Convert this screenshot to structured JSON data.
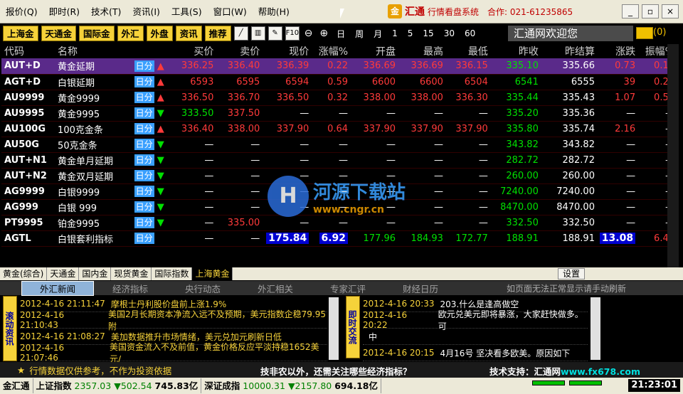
{
  "menu": [
    "报价(Q)",
    "即时(R)",
    "技术(T)",
    "资讯(I)",
    "工具(S)",
    "窗口(W)",
    "帮助(H)"
  ],
  "brand": {
    "logo": "金",
    "name": "汇通",
    "sub": "行情看盘系统",
    "phone": "合作: 021-61235865"
  },
  "window_buttons": [
    "_",
    "▫",
    "×"
  ],
  "toolbar": {
    "markets": [
      "上海金",
      "天通金",
      "国际金",
      "外汇",
      "外盘",
      "资讯",
      "推荐"
    ],
    "f10": "F10",
    "periods": [
      "日",
      "周",
      "月",
      "1",
      "5",
      "15",
      "30",
      "60"
    ],
    "welcome": "汇通网欢迎您",
    "mail_count": "(0)"
  },
  "table": {
    "headers": [
      "代码",
      "名称",
      "",
      "买价",
      "卖价",
      "现价",
      "涨幅%",
      "开盘",
      "最高",
      "最低",
      "昨收",
      "昨结算",
      "涨跌",
      "振幅%"
    ],
    "tag": "日分",
    "rows": [
      {
        "code": "AUT+D",
        "name": "黄金延期",
        "dir": "up",
        "buy": "336.25",
        "sell": "336.40",
        "price": "336.39",
        "pct": "0.22",
        "open": "336.69",
        "high": "336.69",
        "low": "336.15",
        "prev": "335.10",
        "settle": "335.66",
        "chg": "0.73",
        "amp": "0.16",
        "sel": true
      },
      {
        "code": "AGT+D",
        "name": "白银延期",
        "dir": "up",
        "buy": "6593",
        "sell": "6595",
        "price": "6594",
        "pct": "0.59",
        "open": "6600",
        "high": "6600",
        "low": "6504",
        "prev": "6541",
        "settle": "6555",
        "chg": "39",
        "amp": "0.24"
      },
      {
        "code": "AU9999",
        "name": "黄金9999",
        "dir": "up",
        "buy": "336.50",
        "sell": "336.70",
        "price": "336.50",
        "pct": "0.32",
        "open": "338.00",
        "high": "338.00",
        "low": "336.30",
        "prev": "335.44",
        "settle": "335.43",
        "chg": "1.07",
        "amp": "0.51"
      },
      {
        "code": "AU9995",
        "name": "黄金9995",
        "dir": "down",
        "buy": "333.50",
        "sell": "337.50",
        "price": "—",
        "pct": "—",
        "open": "—",
        "high": "—",
        "low": "—",
        "prev": "335.20",
        "settle": "335.36",
        "chg": "—",
        "amp": "—"
      },
      {
        "code": "AU100G",
        "name": "100克金条",
        "dir": "up",
        "buy": "336.40",
        "sell": "338.00",
        "price": "337.90",
        "pct": "0.64",
        "open": "337.90",
        "high": "337.90",
        "low": "337.90",
        "prev": "335.80",
        "settle": "335.74",
        "chg": "2.16",
        "amp": "—"
      },
      {
        "code": "AU50G",
        "name": "50克金条",
        "dir": "down",
        "buy": "—",
        "sell": "—",
        "price": "—",
        "pct": "—",
        "open": "—",
        "high": "—",
        "low": "—",
        "prev": "343.82",
        "settle": "343.82",
        "chg": "—",
        "amp": "—"
      },
      {
        "code": "AUT+N1",
        "name": "黄金单月延期",
        "dir": "down",
        "buy": "—",
        "sell": "—",
        "price": "—",
        "pct": "—",
        "open": "—",
        "high": "—",
        "low": "—",
        "prev": "282.72",
        "settle": "282.72",
        "chg": "—",
        "amp": "—"
      },
      {
        "code": "AUT+N2",
        "name": "黄金双月延期",
        "dir": "down",
        "buy": "—",
        "sell": "—",
        "price": "—",
        "pct": "—",
        "open": "—",
        "high": "—",
        "low": "—",
        "prev": "260.00",
        "settle": "260.00",
        "chg": "—",
        "amp": "—"
      },
      {
        "code": "AG9999",
        "name": "白银9999",
        "dir": "down",
        "buy": "—",
        "sell": "—",
        "price": "—",
        "pct": "—",
        "open": "—",
        "high": "—",
        "low": "—",
        "prev": "7240.00",
        "settle": "7240.00",
        "chg": "—",
        "amp": "—"
      },
      {
        "code": "AG999",
        "name": "白银 999",
        "dir": "down",
        "buy": "—",
        "sell": "—",
        "price": "—",
        "pct": "—",
        "open": "—",
        "high": "—",
        "low": "—",
        "prev": "8470.00",
        "settle": "8470.00",
        "chg": "—",
        "amp": "—"
      },
      {
        "code": "PT9995",
        "name": "铂金9995",
        "dir": "down",
        "buy": "—",
        "sell": "335.00",
        "price": "—",
        "pct": "—",
        "open": "—",
        "high": "—",
        "low": "—",
        "prev": "332.50",
        "settle": "332.50",
        "chg": "—",
        "amp": "—"
      },
      {
        "code": "AGTL",
        "name": "白银套利指标",
        "dir": "none",
        "buy": "—",
        "sell": "—",
        "price": "175.84",
        "pct": "6.92",
        "open": "177.96",
        "high": "184.93",
        "low": "172.77",
        "prev": "188.91",
        "settle": "188.91",
        "chg": "13.08",
        "amp": "6.43",
        "boxed": true
      }
    ]
  },
  "sheet_tabs": [
    "黄金(综合)",
    "天通金",
    "国内金",
    "现货黄金",
    "国际指数",
    "上海黄金"
  ],
  "sheet_active": 5,
  "settings_label": "设置",
  "news_tabs": [
    "外汇新闻",
    "经济指标",
    "央行动态",
    "外汇相关",
    "专家汇评",
    "财经日历"
  ],
  "news_extra": "如页面无法正常显示请手动刷新",
  "news_left_label": "滚动资讯",
  "news_right_label": "即时交流",
  "news_left": [
    {
      "time": "2012-4-16 21:11:47",
      "text": "摩根士丹利股价盘前上涨1.9%"
    },
    {
      "time": "2012-4-16 21:10:43",
      "text": "美国2月长期资本净流入远不及预期，美元指数企稳79.95附"
    },
    {
      "time": "2012-4-16 21:08:27",
      "text": "美加数据推升市场情绪，美元兑加元刷新日低"
    },
    {
      "time": "2012-4-16 21:07:46",
      "text": "美国资金流入不及前值，黄金价格反应平淡持稳1652美元/"
    }
  ],
  "news_right": [
    {
      "time": "2012-4-16 20:33",
      "text": "203.什么是逢高做空"
    },
    {
      "time": "2012-4-16 20:22",
      "text": "欧元兑美元即将暴涨，大家赶快做多。可"
    },
    {
      "time": "",
      "text": "中"
    },
    {
      "time": "2012-4-16 20:15",
      "text": "4月16号 坚决看多欧美。原因如下"
    }
  ],
  "status": {
    "disclaimer": "行情数据仅供参考，不作为投资依据",
    "question": "技非农以外，还需关注哪些经济指标？",
    "support": "技术支持：汇通网",
    "support_url": "www.fx678.com"
  },
  "index_bar": {
    "logo": "金汇通",
    "sh_label": "上证指数",
    "sh_value": "2357.03",
    "sh_change": "▼502.54",
    "sh_amount": "745.83亿",
    "sz_label": "深证成指",
    "sz_value": "10000.31",
    "sz_change": "▼2157.80",
    "sz_amount": "694.18亿",
    "clock": "21:23:01"
  },
  "watermark": {
    "logo": "H",
    "title": "河源下载站",
    "url": "www.cngr.cn"
  }
}
